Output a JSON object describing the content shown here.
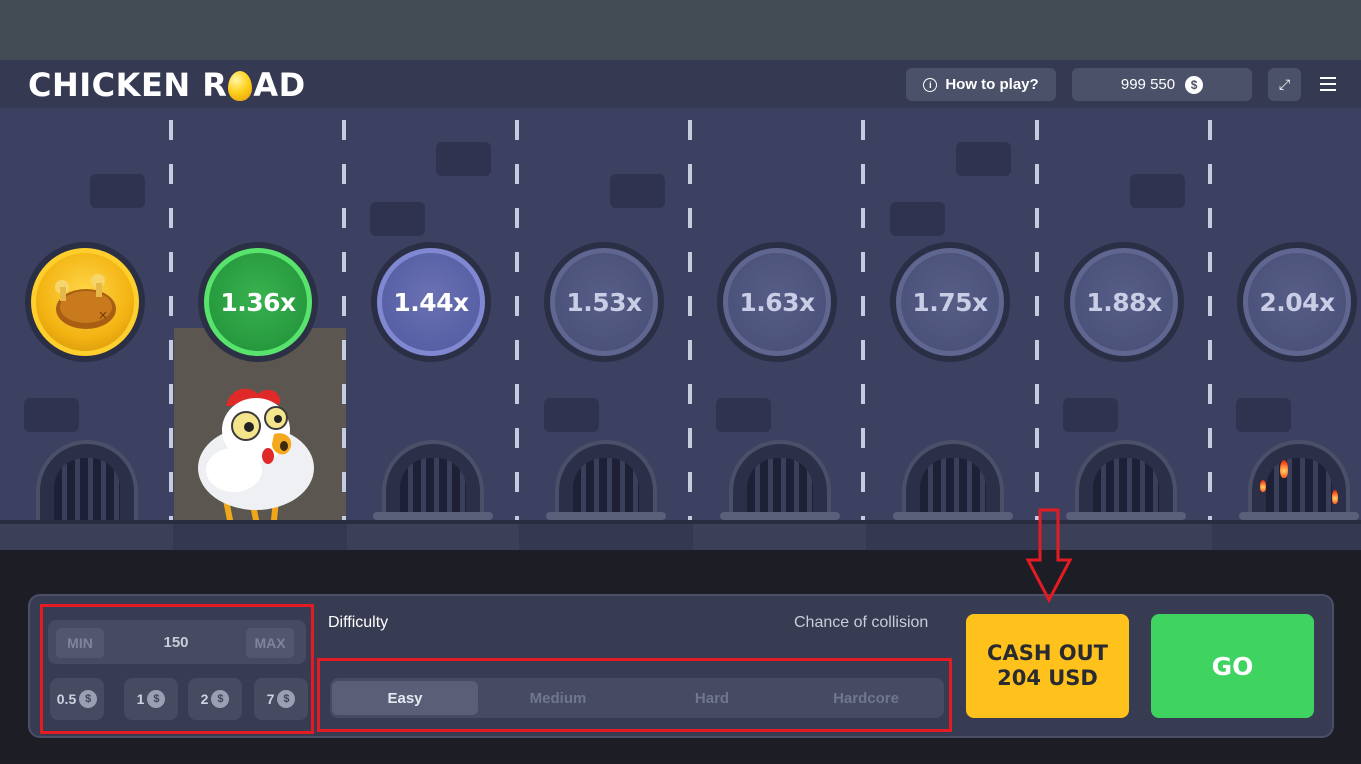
{
  "header": {
    "logo_part1": "CHICKEN R",
    "logo_part2": "AD",
    "how_to_play": "How to play?",
    "info_glyph": "i",
    "balance": "999 550",
    "currency_glyph": "$",
    "fullscreen_glyph": "⤢"
  },
  "road": {
    "multipliers": [
      {
        "label": "",
        "state": "collected"
      },
      {
        "label": "1.36x",
        "state": "current"
      },
      {
        "label": "1.44x",
        "state": "next"
      },
      {
        "label": "1.53x",
        "state": "upcoming"
      },
      {
        "label": "1.63x",
        "state": "upcoming"
      },
      {
        "label": "1.75x",
        "state": "upcoming"
      },
      {
        "label": "1.88x",
        "state": "upcoming"
      },
      {
        "label": "2.04x",
        "state": "upcoming"
      }
    ]
  },
  "bet": {
    "min_label": "MIN",
    "max_label": "MAX",
    "value": "150",
    "chips": [
      {
        "label": "0.5",
        "glyph": "$"
      },
      {
        "label": "1",
        "glyph": "$"
      },
      {
        "label": "2",
        "glyph": "$"
      },
      {
        "label": "7",
        "glyph": "$"
      }
    ]
  },
  "difficulty": {
    "label": "Difficulty",
    "chance_label": "Chance of collision",
    "options": [
      "Easy",
      "Medium",
      "Hard",
      "Hardcore"
    ],
    "selected": "Easy"
  },
  "actions": {
    "cashout_line1": "CASH OUT",
    "cashout_line2": "204 USD",
    "go": "GO"
  },
  "colors": {
    "cashout": "#ffc21c",
    "go": "#3fd35f",
    "current_multiplier": "#39b24f",
    "highlight": "#e31b23"
  }
}
